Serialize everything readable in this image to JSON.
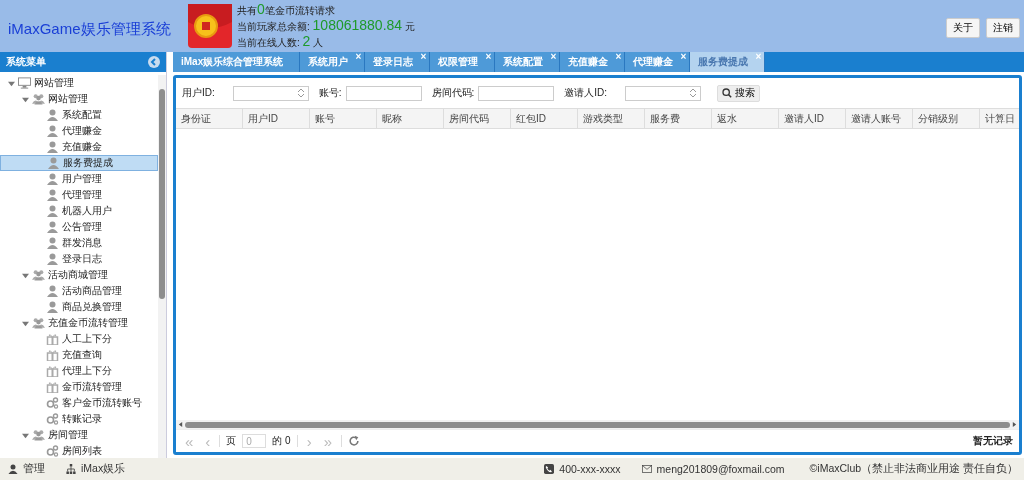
{
  "header": {
    "title": "iMaxGame娱乐管理系统",
    "notice": {
      "prefix": "共有",
      "count": "0",
      "suffix": "笔金币流转请求"
    },
    "balance": {
      "label": "当前玩家总余额:",
      "value": "108061880.84",
      "unit": "元"
    },
    "online": {
      "label": "当前在线人数:",
      "value": "2",
      "unit": "人"
    },
    "buttons": [
      "关于",
      "注销"
    ]
  },
  "sidebar": {
    "title": "系统菜单",
    "tree": [
      {
        "label": "网站管理",
        "kind": "computer",
        "expanded": true,
        "selected": false,
        "children": [
          {
            "label": "网站管理",
            "kind": "group",
            "expanded": true,
            "selected": false,
            "children": [
              {
                "label": "系统配置",
                "kind": "user",
                "selected": false
              },
              {
                "label": "代理赚金",
                "kind": "user",
                "selected": false
              },
              {
                "label": "充值赚金",
                "kind": "user",
                "selected": false
              },
              {
                "label": "服务费提成",
                "kind": "user",
                "selected": true
              },
              {
                "label": "用户管理",
                "kind": "user",
                "selected": false
              },
              {
                "label": "代理管理",
                "kind": "user",
                "selected": false
              },
              {
                "label": "机器人用户",
                "kind": "user",
                "selected": false
              },
              {
                "label": "公告管理",
                "kind": "user",
                "selected": false
              },
              {
                "label": "群发消息",
                "kind": "user",
                "selected": false
              },
              {
                "label": "登录日志",
                "kind": "user",
                "selected": false
              }
            ]
          },
          {
            "label": "活动商城管理",
            "kind": "group",
            "expanded": true,
            "selected": false,
            "children": [
              {
                "label": "活动商品管理",
                "kind": "user",
                "selected": false
              },
              {
                "label": "商品兑换管理",
                "kind": "user",
                "selected": false
              }
            ]
          },
          {
            "label": "充值金币流转管理",
            "kind": "group",
            "expanded": true,
            "selected": false,
            "children": [
              {
                "label": "人工上下分",
                "kind": "gift",
                "selected": false
              },
              {
                "label": "充值查询",
                "kind": "gift",
                "selected": false
              },
              {
                "label": "代理上下分",
                "kind": "gift",
                "selected": false
              },
              {
                "label": "金币流转管理",
                "kind": "gift",
                "selected": false
              },
              {
                "label": "客户金币流转账号",
                "kind": "gears",
                "selected": false
              },
              {
                "label": "转账记录",
                "kind": "gears",
                "selected": false
              }
            ]
          },
          {
            "label": "房间管理",
            "kind": "group",
            "expanded": true,
            "selected": false,
            "children": [
              {
                "label": "房间列表",
                "kind": "gears",
                "selected": false
              }
            ]
          }
        ]
      }
    ]
  },
  "tabs": [
    {
      "label": "iMax娱乐综合管理系统",
      "closable": false,
      "selected": false
    },
    {
      "label": "系统用户",
      "closable": true,
      "selected": false
    },
    {
      "label": "登录日志",
      "closable": true,
      "selected": false
    },
    {
      "label": "权限管理",
      "closable": true,
      "selected": false
    },
    {
      "label": "系统配置",
      "closable": true,
      "selected": false
    },
    {
      "label": "充值赚金",
      "closable": true,
      "selected": false
    },
    {
      "label": "代理赚金",
      "closable": true,
      "selected": false
    },
    {
      "label": "服务费提成",
      "closable": true,
      "selected": true
    }
  ],
  "close_glyph": "×",
  "filters": [
    {
      "label": "用户ID:",
      "kind": "number"
    },
    {
      "label": "账号:",
      "kind": "text"
    },
    {
      "label": "房间代码:",
      "kind": "text"
    },
    {
      "label": "邀请人ID:",
      "kind": "number"
    }
  ],
  "search_button": "搜索",
  "table": {
    "columns": [
      "身份证",
      "用户ID",
      "账号",
      "昵称",
      "房间代码",
      "红包ID",
      "游戏类型",
      "服务费",
      "返水",
      "邀请人ID",
      "邀请人账号",
      "分销级别",
      "计算日"
    ]
  },
  "pager": {
    "first": "«",
    "prev": "‹",
    "page_label": "页",
    "page_value": "0",
    "of": "的 0",
    "next": "›",
    "last": "»",
    "status": "暂无记录"
  },
  "footer": {
    "user": "管理",
    "org": "iMax娱乐",
    "phone": "400-xxx-xxxx",
    "email": "meng201809@foxmail.com",
    "copyright": "©iMaxClub（禁止非法商业用途 责任自负）"
  }
}
